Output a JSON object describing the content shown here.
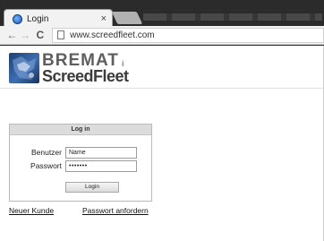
{
  "browser": {
    "tab_title": "Login",
    "tab_close": "×",
    "url": "www.screedfleet.com",
    "back_icon": "←",
    "forward_icon": "→",
    "reload_icon": "C"
  },
  "logo": {
    "line1": "BREMAT",
    "line1_suffix": "i",
    "line2": "ScreedFleet"
  },
  "login": {
    "header": "Log in",
    "user_label": "Benutzer",
    "user_value": "Name",
    "password_label": "Passwort",
    "password_value": "•••••••",
    "submit_label": "Login"
  },
  "links": {
    "new_customer": "Neuer Kunde",
    "request_password": "Passwort anfordern"
  }
}
